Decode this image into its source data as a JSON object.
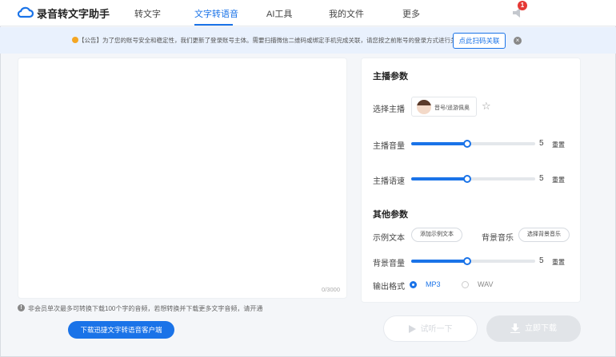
{
  "header": {
    "app_title": "录音转文字助手",
    "nav": [
      "转文字",
      "文字转语音",
      "AI工具",
      "我的文件",
      "更多"
    ],
    "active_nav": "文字转语音",
    "notification_count": "1"
  },
  "notice": {
    "text": "【公告】为了您的账号安全和稳定性，我们更新了登录账号主体。需要扫描微信二维码或绑定手机完成关联，请您按之前账号的登录方式进行关联。",
    "button_label": "点此扫码关联"
  },
  "editor": {
    "char_count": "0/3000",
    "tip": "非会员单次最多可转换下载100个字的音频，若想转换并下载更多文字音频，请开通",
    "download_client_label": "下载迅捷文字转语音客户端"
  },
  "panel": {
    "anchor_section": "主播参数",
    "select_anchor_label": "选择主播",
    "anchor_name": "晋号/遥游佩奥",
    "volume_label": "主播音量",
    "volume_value": "5",
    "volume_fraction": 0.45,
    "speed_label": "主播语速",
    "speed_value": "5",
    "speed_fraction": 0.45,
    "reset_label": "重置",
    "other_section": "其他参数",
    "sample_text_label": "示例文本",
    "add_sample_label": "添加示例文本",
    "bg_music_label": "背景音乐",
    "select_bg_music_label": "选择背景音乐",
    "bg_volume_label": "背景音量",
    "bg_volume_value": "5",
    "bg_volume_fraction": 0.45,
    "format_label": "输出格式",
    "format_options": [
      "MP3",
      "WAV"
    ],
    "selected_format": "MP3"
  },
  "actions": {
    "listen_label": "试听一下",
    "download_label": "立即下载"
  },
  "colors": {
    "accent": "#1a73e8",
    "notice_bg": "#e9f1fd",
    "badge": "#e53935"
  }
}
